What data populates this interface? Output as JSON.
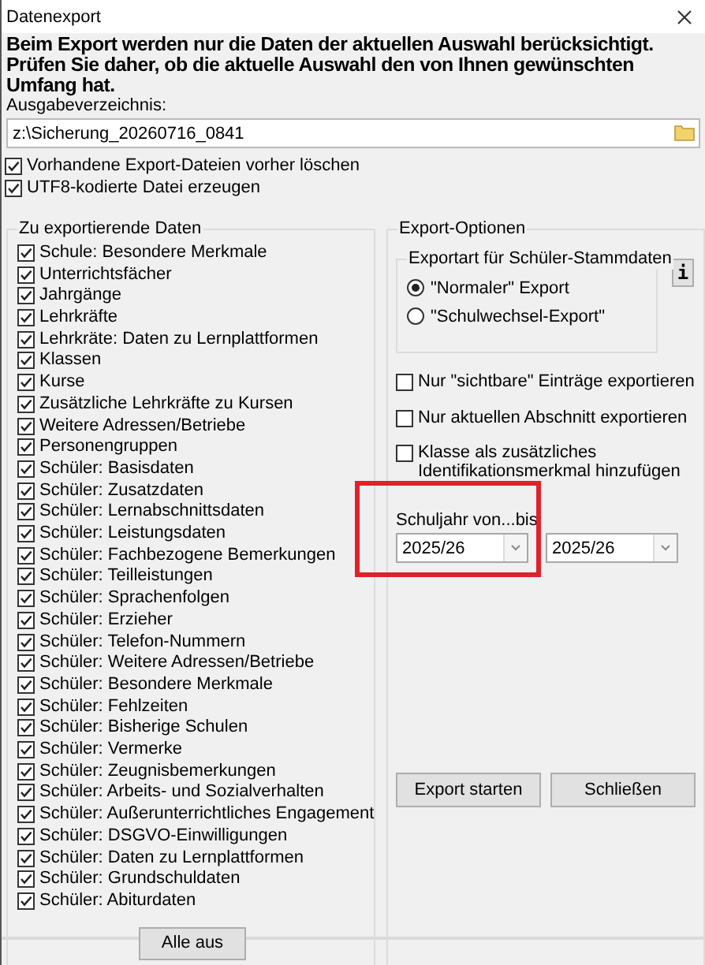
{
  "window": {
    "title": "Datenexport"
  },
  "notice": "Beim Export werden nur die Daten der aktuellen Auswahl berücksichtigt. Prüfen Sie daher, ob die aktuelle Auswahl den von Ihnen gewünschten Umfang hat.",
  "output_dir": {
    "label": "Ausgabeverzeichnis:",
    "value": "z:\\Sicherung_20260716_0841"
  },
  "options": [
    {
      "label": "Vorhandene Export-Dateien vorher löschen",
      "checked": true
    },
    {
      "label": "UTF8-kodierte Datei erzeugen",
      "checked": true
    }
  ],
  "data_group": {
    "title": "Zu exportierende Daten",
    "items": [
      {
        "label": "Schule: Besondere Merkmale",
        "checked": true
      },
      {
        "label": "Unterrichtsfächer",
        "checked": true
      },
      {
        "label": "Jahrgänge",
        "checked": true
      },
      {
        "label": "Lehrkräfte",
        "checked": true
      },
      {
        "label": "Lehrkräte: Daten zu Lernplattformen",
        "checked": true
      },
      {
        "label": "Klassen",
        "checked": true
      },
      {
        "label": "Kurse",
        "checked": true
      },
      {
        "label": "Zusätzliche Lehrkräfte zu Kursen",
        "checked": true
      },
      {
        "label": "Weitere Adressen/Betriebe",
        "checked": true
      },
      {
        "label": "Personengruppen",
        "checked": true
      },
      {
        "label": "Schüler: Basisdaten",
        "checked": true
      },
      {
        "label": "Schüler: Zusatzdaten",
        "checked": true
      },
      {
        "label": "Schüler: Lernabschnittsdaten",
        "checked": true
      },
      {
        "label": "Schüler: Leistungsdaten",
        "checked": true
      },
      {
        "label": "Schüler: Fachbezogene Bemerkungen",
        "checked": true
      },
      {
        "label": "Schüler: Teilleistungen",
        "checked": true
      },
      {
        "label": "Schüler: Sprachenfolgen",
        "checked": true
      },
      {
        "label": "Schüler: Erzieher",
        "checked": true
      },
      {
        "label": "Schüler: Telefon-Nummern",
        "checked": true
      },
      {
        "label": "Schüler: Weitere Adressen/Betriebe",
        "checked": true
      },
      {
        "label": "Schüler: Besondere Merkmale",
        "checked": true
      },
      {
        "label": "Schüler: Fehlzeiten",
        "checked": true
      },
      {
        "label": "Schüler: Bisherige Schulen",
        "checked": true
      },
      {
        "label": "Schüler: Vermerke",
        "checked": true
      },
      {
        "label": "Schüler: Zeugnisbemerkungen",
        "checked": true
      },
      {
        "label": "Schüler: Arbeits- und Sozialverhalten",
        "checked": true
      },
      {
        "label": "Schüler: Außerunterrichtliches Engagement",
        "checked": true
      },
      {
        "label": "Schüler: DSGVO-Einwilligungen",
        "checked": true
      },
      {
        "label": "Schüler: Daten zu Lernplattformen",
        "checked": true
      },
      {
        "label": "Schüler: Grundschuldaten",
        "checked": true
      },
      {
        "label": "Schüler: Abiturdaten",
        "checked": true
      }
    ],
    "button": "Alle aus"
  },
  "export_options": {
    "title": "Export-Optionen",
    "type_group": {
      "title": "Exportart für Schüler-Stammdaten",
      "choices": [
        {
          "label": "\"Normaler\" Export",
          "selected": true
        },
        {
          "label": "\"Schulwechsel-Export\"",
          "selected": false
        }
      ]
    },
    "info_button": "i",
    "checks": [
      {
        "label": "Nur \"sichtbare\" Einträge exportieren",
        "checked": false
      },
      {
        "label": "Nur aktuellen Abschnitt exportieren",
        "checked": false
      },
      {
        "label": "Klasse als zusätzliches Identifikationsmerkmal hinzufügen",
        "checked": false
      }
    ],
    "school_year": {
      "label": "Schuljahr von...bis",
      "highlighted": true,
      "from": "2025/26",
      "to": "2025/26"
    },
    "buttons": [
      "Export starten",
      "Schließen"
    ]
  }
}
